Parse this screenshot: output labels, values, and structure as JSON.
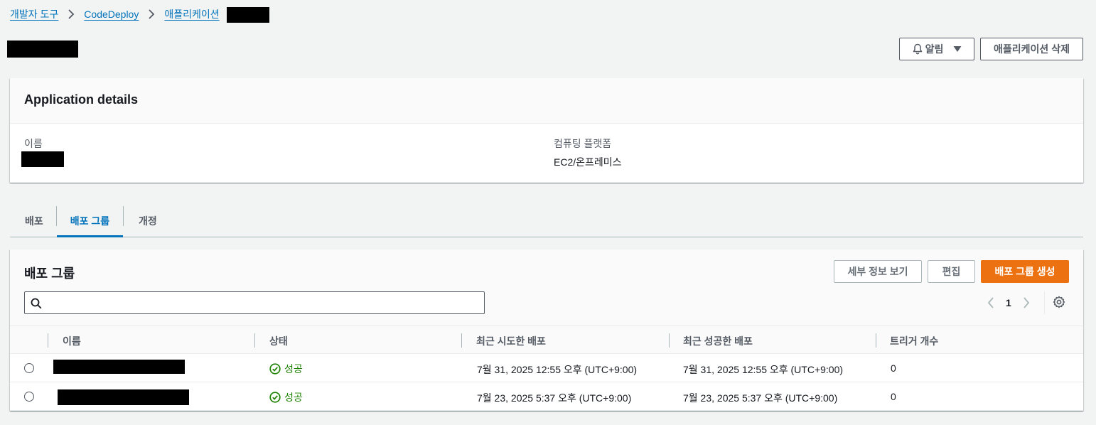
{
  "breadcrumb": {
    "items": [
      "개발자 도구",
      "CodeDeploy",
      "애플리케이션"
    ]
  },
  "header": {
    "notify_label": "알림",
    "delete_label": "애플리케이션 삭제"
  },
  "details": {
    "title": "Application details",
    "name_label": "이름",
    "platform_label": "컴퓨팅 플랫폼",
    "platform_value": "EC2/온프레미스"
  },
  "tabs": [
    {
      "label": "배포",
      "active": false
    },
    {
      "label": "배포 그룹",
      "active": true
    },
    {
      "label": "개정",
      "active": false
    }
  ],
  "groups_panel": {
    "title": "배포 그룹",
    "view_details_label": "세부 정보 보기",
    "edit_label": "편집",
    "create_label": "배포 그룹 생성",
    "search_placeholder": "",
    "page_current": "1",
    "columns": [
      "이름",
      "상태",
      "최근 시도한 배포",
      "최근 성공한 배포",
      "트리거 개수"
    ],
    "rows": [
      {
        "status": "성공",
        "last_attempted": "7월 31, 2025 12:55 오후 (UTC+9:00)",
        "last_successful": "7월 31, 2025 12:55 오후 (UTC+9:00)",
        "triggers": "0"
      },
      {
        "status": "성공",
        "last_attempted": "7월 23, 2025 5:37 오후 (UTC+9:00)",
        "last_successful": "7월 23, 2025 5:37 오후 (UTC+9:00)",
        "triggers": "0"
      }
    ]
  },
  "colors": {
    "link": "#0073bb",
    "primary": "#ec7211",
    "success": "#1d8102"
  }
}
